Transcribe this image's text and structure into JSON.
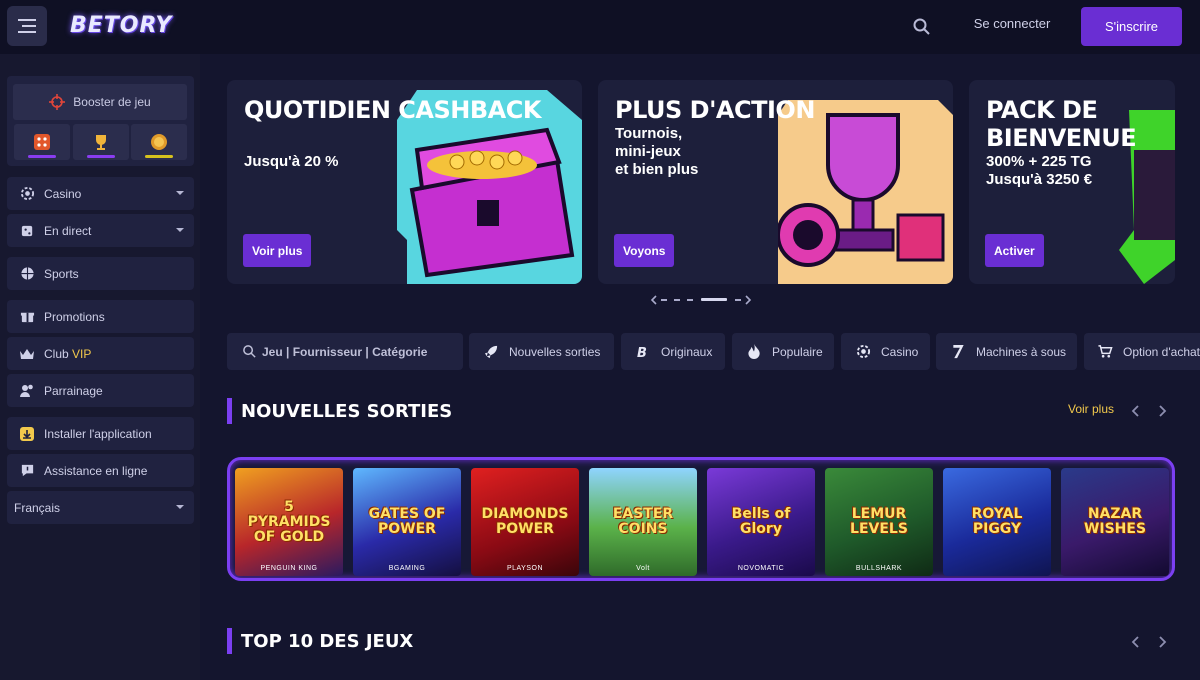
{
  "header": {
    "logo": "BETORY",
    "login_label": "Se connecter",
    "signup_label": "S'inscrire"
  },
  "sidebar": {
    "booster_label": "Booster de jeu",
    "items": [
      {
        "label": "Casino",
        "icon": "casino-chip-icon"
      },
      {
        "label": "En direct",
        "icon": "live-dice-icon"
      },
      {
        "label": "Sports",
        "icon": "basketball-icon"
      },
      {
        "label": "Promotions",
        "icon": "gift-icon"
      },
      {
        "label": "Club ",
        "label_highlight": "VIP",
        "icon": "crown-icon"
      },
      {
        "label": "Parrainage",
        "icon": "users-icon"
      },
      {
        "label": "Installer l'application",
        "icon": "download-icon"
      },
      {
        "label": "Assistance en ligne",
        "icon": "chat-icon"
      }
    ],
    "language": "Français"
  },
  "banners": [
    {
      "title": "Quotidien cashback",
      "sub": "Jusqu'à 20 %",
      "button": "Voir plus"
    },
    {
      "title": "Plus d'action",
      "sub": "Tournois,\nmini-jeux\net bien plus",
      "button": "Voyons"
    },
    {
      "title": "Pack de bienvenue",
      "sub": "300% + 225 TG\nJusqu'à 3250 €",
      "button": "Activer"
    }
  ],
  "filters": {
    "search_placeholder": "Jeu | Fournisseur | Catégorie",
    "tabs": [
      "Nouvelles sorties",
      "Originaux",
      "Populaire",
      "Casino",
      "Machines à sous",
      "Option d'achat"
    ]
  },
  "sections": {
    "new_releases": "NOUVELLES SORTIES",
    "see_more": "Voir plus",
    "top10": "TOP 10 DES JEUX"
  },
  "games": [
    {
      "title": "5 PYRAMIDS OF GOLD",
      "provider": "PENGUIN KING"
    },
    {
      "title": "GATES OF POWER",
      "provider": "BGAMING"
    },
    {
      "title": "DIAMONDS POWER",
      "provider": "PLAYSON"
    },
    {
      "title": "EASTER COINS",
      "provider": "Volt"
    },
    {
      "title": "Bells of Glory",
      "provider": "NOVOMATIC"
    },
    {
      "title": "LEMUR LEVELS",
      "provider": "BULLSHARK"
    },
    {
      "title": "ROYAL PIGGY",
      "provider": ""
    },
    {
      "title": "NAZAR WISHES",
      "provider": ""
    }
  ],
  "colors": {
    "accent": "#6a2ed3",
    "vip": "#f2c94c",
    "bg": "#14152e"
  }
}
